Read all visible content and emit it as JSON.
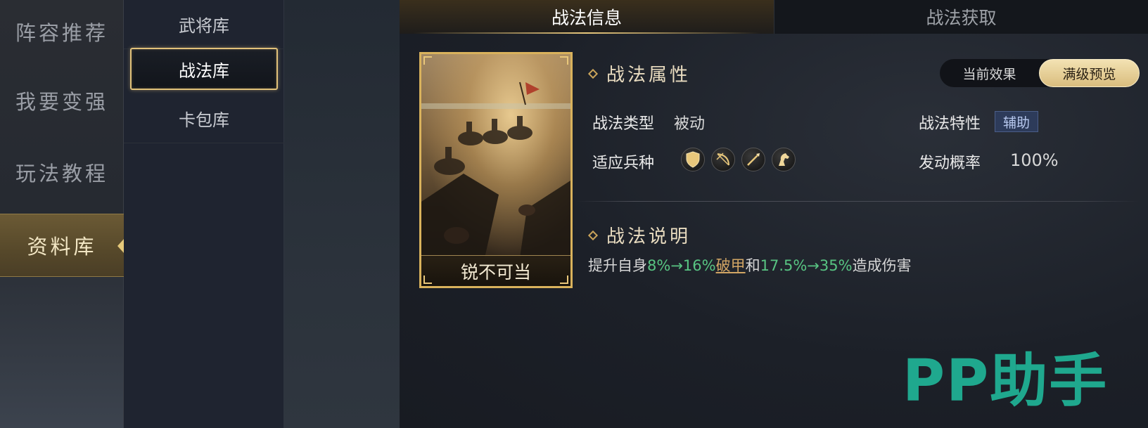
{
  "left_nav": {
    "items": [
      {
        "label": "阵容推荐"
      },
      {
        "label": "我要变强"
      },
      {
        "label": "玩法教程"
      },
      {
        "label": "资料库"
      }
    ]
  },
  "sub_nav": {
    "items": [
      {
        "label": "武将库"
      },
      {
        "label": "战法库"
      },
      {
        "label": "卡包库"
      }
    ]
  },
  "tabs": [
    {
      "label": "战法信息"
    },
    {
      "label": "战法获取"
    }
  ],
  "card": {
    "name": "锐不可当"
  },
  "attributes": {
    "title": "战法属性",
    "toggle": {
      "current": "当前效果",
      "max": "满级预览"
    },
    "type_label": "战法类型",
    "type_value": "被动",
    "feature_label": "战法特性",
    "feature_value": "辅助",
    "troop_label": "适应兵种",
    "troop_icons": [
      "shield-icon",
      "bow-icon",
      "spear-icon",
      "horse-icon"
    ],
    "rate_label": "发动概率",
    "rate_value": "100%"
  },
  "description": {
    "title": "战法说明",
    "prefix": "提升自身",
    "value1": "8%→16%",
    "keyword": "破甲",
    "middle": "和",
    "value2": "17.5%→35%",
    "suffix": "造成伤害"
  },
  "watermark": {
    "text": "PP助手"
  },
  "colors": {
    "accent_gold": "#e2c27a",
    "highlight_green": "#58c482",
    "tag_blue": "#2d3b5a",
    "watermark": "#1fa88e"
  }
}
